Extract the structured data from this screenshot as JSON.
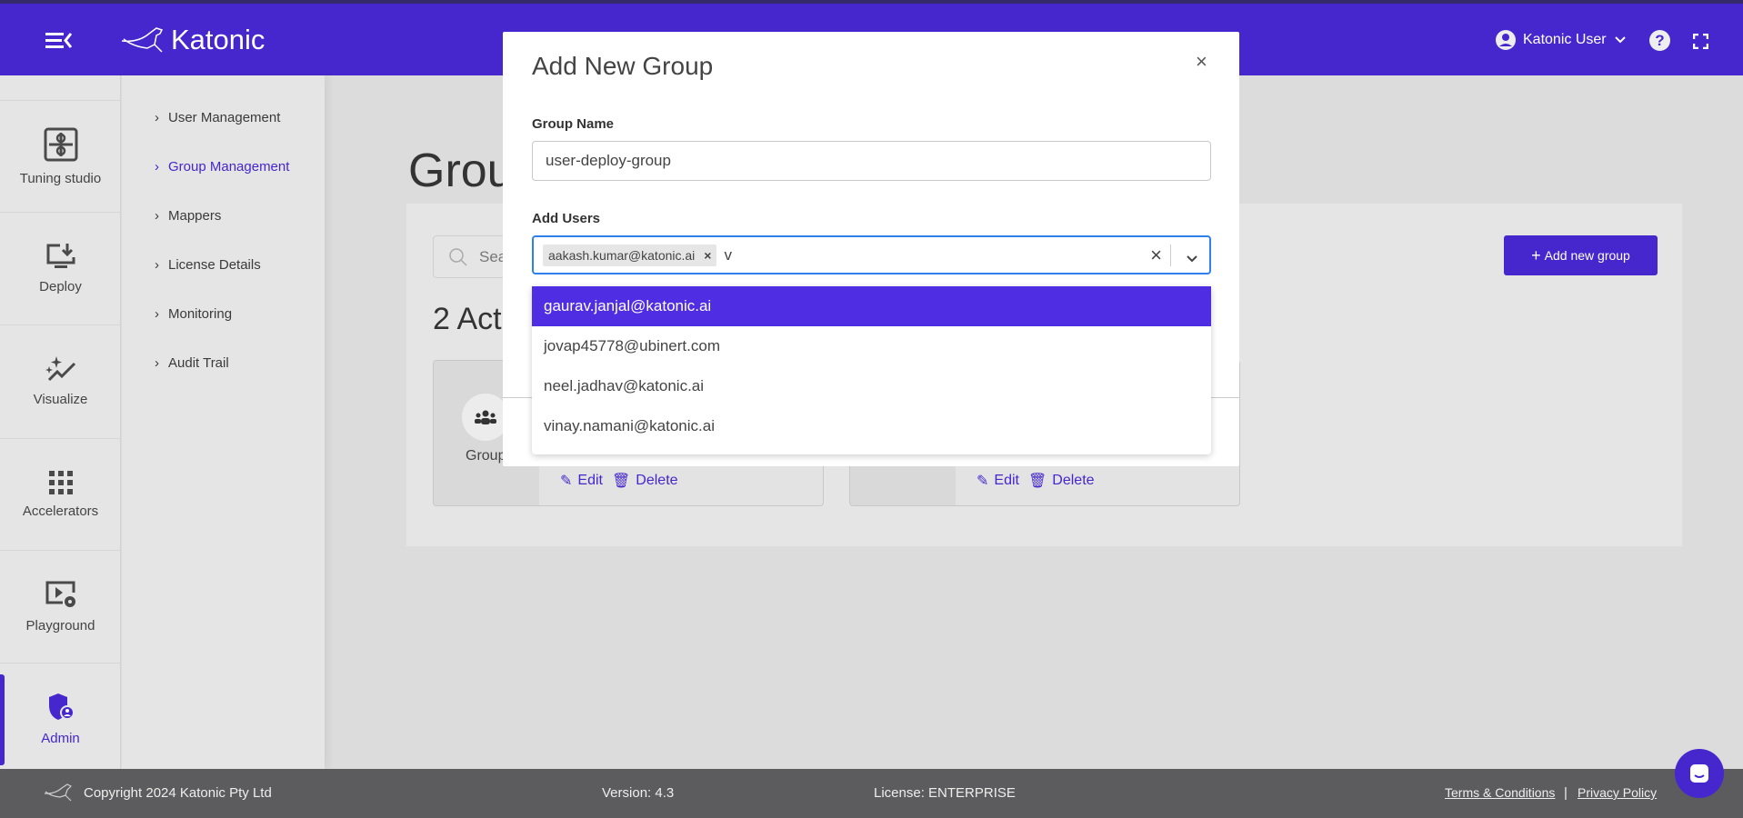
{
  "header": {
    "brand": "Katonic",
    "user": "Katonic User"
  },
  "rail": [
    {
      "label": "Tuning studio",
      "icon": "puzzle-icon"
    },
    {
      "label": "Deploy",
      "icon": "monitor-download-icon"
    },
    {
      "label": "Visualize",
      "icon": "sparkle-chart-icon"
    },
    {
      "label": "Accelerators",
      "icon": "grid-icon"
    },
    {
      "label": "Playground",
      "icon": "video-settings-icon"
    },
    {
      "label": "Admin",
      "icon": "shield-user-icon",
      "active": true
    }
  ],
  "submenu": [
    {
      "label": "User Management"
    },
    {
      "label": "Group Management",
      "active": true
    },
    {
      "label": "Mappers"
    },
    {
      "label": "License Details"
    },
    {
      "label": "Monitoring"
    },
    {
      "label": "Audit Trail"
    }
  ],
  "main": {
    "title": "Grou",
    "search_placeholder": "Sear",
    "count_text": "2 Act",
    "add_button": "Add new group",
    "card_label": "Group",
    "edit": "Edit",
    "delete": "Delete"
  },
  "modal": {
    "title": "Add New Group",
    "group_name_label": "Group Name",
    "group_name_value": "user-deploy-group",
    "add_users_label": "Add Users",
    "selected_chip": "aakash.kumar@katonic.ai",
    "typed": "v",
    "options": [
      "gaurav.janjal@katonic.ai",
      "jovap45778@ubinert.com",
      "neel.jadhav@katonic.ai",
      "vinay.namani@katonic.ai"
    ]
  },
  "footer": {
    "copyright": "Copyright 2024 Katonic Pty Ltd",
    "version": "Version: 4.3",
    "license": "License: ENTERPRISE",
    "terms": "Terms & Conditions",
    "separator": "|",
    "privacy": "Privacy Policy"
  },
  "colors": {
    "brand": "#4527cd",
    "highlight": "#4e2de3",
    "footer": "#5c5c5e"
  }
}
